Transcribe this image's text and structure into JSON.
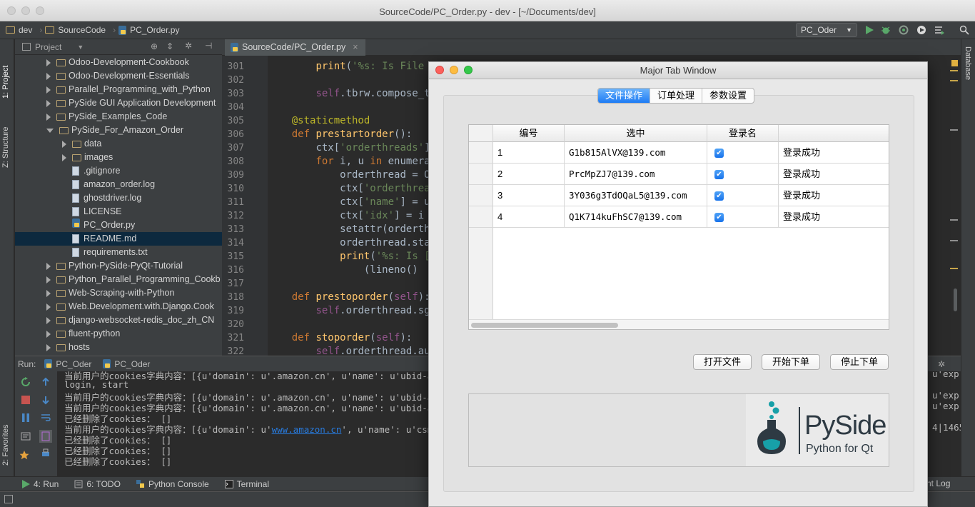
{
  "window": {
    "title": "SourceCode/PC_Order.py - dev - [~/Documents/dev]"
  },
  "nav": {
    "root": "dev",
    "folder": "SourceCode",
    "file": "PC_Order.py",
    "run_config": "PC_Oder"
  },
  "side_tabs": {
    "project": "1: Project",
    "structure": "Z: Structure",
    "favorites": "2: Favorites",
    "database": "Database"
  },
  "project_panel": {
    "title": "Project",
    "items": [
      {
        "label": "Odoo-Development-Cookbook",
        "kind": "folder"
      },
      {
        "label": "Odoo-Development-Essentials",
        "kind": "folder"
      },
      {
        "label": "Parallel_Programming_with_Python",
        "kind": "folder"
      },
      {
        "label": "PySide GUI Application Development",
        "kind": "folder"
      },
      {
        "label": "PySide_Examples_Code",
        "kind": "folder"
      },
      {
        "label": "PySide_For_Amazon_Order",
        "kind": "folder-open"
      },
      {
        "label": "data",
        "kind": "folder"
      },
      {
        "label": "images",
        "kind": "folder"
      },
      {
        "label": ".gitignore",
        "kind": "file"
      },
      {
        "label": "amazon_order.log",
        "kind": "file"
      },
      {
        "label": "ghostdriver.log",
        "kind": "file"
      },
      {
        "label": "LICENSE",
        "kind": "file"
      },
      {
        "label": "PC_Order.py",
        "kind": "py"
      },
      {
        "label": "README.md",
        "kind": "md",
        "selected": true
      },
      {
        "label": "requirements.txt",
        "kind": "file"
      },
      {
        "label": "Python-PySide-PyQt-Tutorial",
        "kind": "folder"
      },
      {
        "label": "Python_Parallel_Programming_Cookb",
        "kind": "folder"
      },
      {
        "label": "Web-Scraping-with-Python",
        "kind": "folder"
      },
      {
        "label": "Web.Development.with.Django.Cook",
        "kind": "folder"
      },
      {
        "label": "django-websocket-redis_doc_zh_CN",
        "kind": "folder"
      },
      {
        "label": "fluent-python",
        "kind": "folder"
      },
      {
        "label": "hosts",
        "kind": "folder"
      }
    ]
  },
  "editor": {
    "tab": "SourceCode/PC_Order.py",
    "line_numbers": [
      "301",
      "302",
      "303",
      "304",
      "305",
      "306",
      "307",
      "308",
      "309",
      "310",
      "311",
      "312",
      "313",
      "314",
      "315",
      "316",
      "317",
      "318",
      "319",
      "320",
      "321",
      "322"
    ],
    "lines": [
      {
        "ind": "        ",
        "segs": [
          [
            "fn",
            "print"
          ],
          [
            "",
            "("
          ],
          [
            "str",
            "'%s: Is File"
          ]
        ]
      },
      {
        "ind": "",
        "segs": []
      },
      {
        "ind": "        ",
        "segs": [
          [
            "self",
            "self"
          ],
          [
            "",
            ".tbrw.compose_t"
          ]
        ]
      },
      {
        "ind": "",
        "segs": []
      },
      {
        "ind": "    ",
        "segs": [
          [
            "dec",
            "@staticmethod"
          ]
        ]
      },
      {
        "ind": "    ",
        "segs": [
          [
            "kw",
            "def "
          ],
          [
            "fn",
            "prestartorder"
          ],
          [
            "",
            "():"
          ]
        ]
      },
      {
        "ind": "        ",
        "segs": [
          [
            "",
            "ctx["
          ],
          [
            "str",
            "'orderthreads'"
          ],
          [
            "",
            "]"
          ]
        ]
      },
      {
        "ind": "        ",
        "segs": [
          [
            "kw",
            "for "
          ],
          [
            "",
            "i, u "
          ],
          [
            "kw",
            "in "
          ],
          [
            "",
            "enumera"
          ]
        ]
      },
      {
        "ind": "            ",
        "segs": [
          [
            "",
            "orderthread = O"
          ]
        ]
      },
      {
        "ind": "            ",
        "segs": [
          [
            "",
            "ctx["
          ],
          [
            "str",
            "'orderthrea"
          ]
        ]
      },
      {
        "ind": "            ",
        "segs": [
          [
            "",
            "ctx["
          ],
          [
            "str",
            "'name'"
          ],
          [
            "",
            "] = u"
          ]
        ]
      },
      {
        "ind": "            ",
        "segs": [
          [
            "",
            "ctx["
          ],
          [
            "str",
            "'idx'"
          ],
          [
            "",
            "] = i"
          ]
        ]
      },
      {
        "ind": "            ",
        "segs": [
          [
            "",
            "setattr(orderth"
          ]
        ]
      },
      {
        "ind": "            ",
        "segs": [
          [
            "",
            "orderthread.sta"
          ]
        ]
      },
      {
        "ind": "            ",
        "segs": [
          [
            "fn",
            "print"
          ],
          [
            "",
            "("
          ],
          [
            "str",
            "'%s: Is ["
          ]
        ]
      },
      {
        "ind": "                ",
        "segs": [
          [
            "",
            "(lineno()"
          ]
        ]
      },
      {
        "ind": "",
        "segs": []
      },
      {
        "ind": "    ",
        "segs": [
          [
            "kw",
            "def "
          ],
          [
            "fn",
            "prestoporder"
          ],
          [
            "",
            "("
          ],
          [
            "self",
            "self"
          ],
          [
            "",
            "):"
          ]
        ]
      },
      {
        "ind": "        ",
        "segs": [
          [
            "self",
            "self"
          ],
          [
            "",
            ".orderthread.sg"
          ]
        ]
      },
      {
        "ind": "",
        "segs": []
      },
      {
        "ind": "    ",
        "segs": [
          [
            "kw",
            "def "
          ],
          [
            "fn",
            "stoporder"
          ],
          [
            "",
            "("
          ],
          [
            "self",
            "self"
          ],
          [
            "",
            "):"
          ]
        ]
      },
      {
        "ind": "        ",
        "segs": [
          [
            "self",
            "self"
          ],
          [
            "",
            ".orderthread.au"
          ]
        ]
      }
    ]
  },
  "run_panel": {
    "label": "Run:",
    "tabs": [
      "PC_Oder",
      "PC_Oder"
    ],
    "output": [
      {
        "text": "当前用户的cookies字典内容：[{u'domain': u'.amazon.cn', u'name': u'ubid-acb",
        "right": "u'exp"
      },
      {
        "text": "login, start",
        "right": ""
      },
      {
        "text": "当前用户的cookies字典内容：[{u'domain': u'.amazon.cn', u'name': u'ubid-acb",
        "right": "u'exp"
      },
      {
        "text": "当前用户的cookies字典内容：[{u'domain': u'.amazon.cn', u'name': u'ubid-acb",
        "right": "u'exp"
      },
      {
        "text": "已经删除了cookies： []",
        "right": ""
      },
      {
        "text_pre": "当前用户的cookies字典内容：[{u'domain': u'",
        "link": "www.amazon.cn",
        "text_post": "', u'name': u'csm-h",
        "right": "4|1465"
      },
      {
        "text": "已经删除了cookies： []",
        "right": ""
      },
      {
        "text": "已经删除了cookies： []",
        "right": ""
      },
      {
        "text": "已经删除了cookies： []",
        "right": ""
      }
    ]
  },
  "bottom_tabs": [
    {
      "label": "4: Run",
      "icon": "run-icon"
    },
    {
      "label": "6: TODO",
      "icon": "todo-icon"
    },
    {
      "label": "Python Console",
      "icon": "python-console-icon"
    },
    {
      "label": "Terminal",
      "icon": "terminal-icon"
    }
  ],
  "event_log": "nt Log",
  "dialog": {
    "title": "Major Tab Window",
    "tabs": [
      "文件操作",
      "订单处理",
      "参数设置"
    ],
    "active_tab": 0,
    "columns": [
      "编号",
      "选中",
      "登录名",
      ""
    ],
    "rows": [
      {
        "id": "1",
        "email": "G1b815AlVX@139.com",
        "checked": true,
        "status": "登录成功"
      },
      {
        "id": "2",
        "email": "PrcMpZJ7@139.com",
        "checked": true,
        "status": "登录成功"
      },
      {
        "id": "3",
        "email": "3Y036g3TdOQaL5@139.com",
        "checked": true,
        "status": "登录成功"
      },
      {
        "id": "4",
        "email": "Q1K714kuFhSC7@139.com",
        "checked": true,
        "status": "登录成功"
      }
    ],
    "buttons": {
      "open_file": "打开文件",
      "start_order": "开始下单",
      "stop_order": "停止下单"
    },
    "logo": {
      "brand": "PySide",
      "tagline": "Python for Qt"
    }
  },
  "colors": {
    "accent": "#1e7cf5",
    "ide_bg": "#2b2b2b",
    "logo_teal": "#17a0a8",
    "logo_dark": "#2e3a43"
  }
}
